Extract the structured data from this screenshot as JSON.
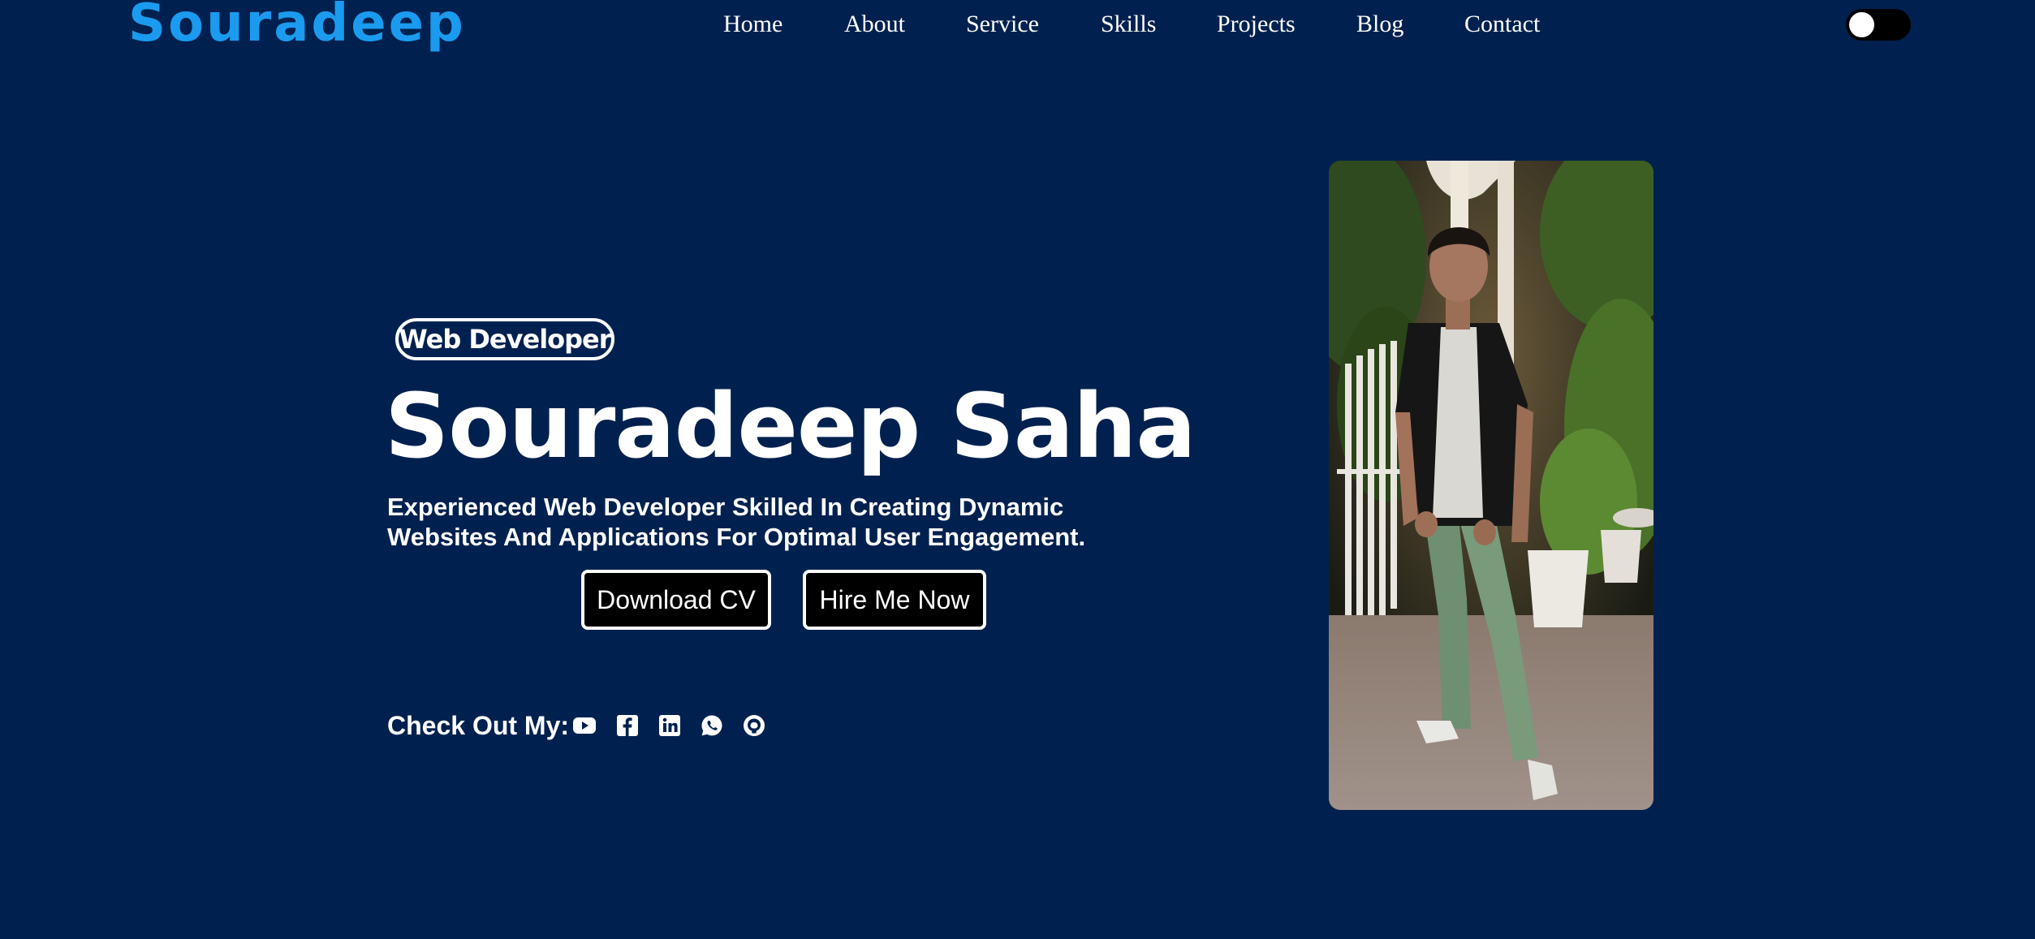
{
  "logo": "Souradeep",
  "nav": {
    "items": [
      "Home",
      "About",
      "Service",
      "Skills",
      "Projects",
      "Blog",
      "Contact"
    ]
  },
  "theme_toggle": {
    "state": "off"
  },
  "hero": {
    "badge": "Web Developer",
    "name": "Souradeep Saha",
    "description": "Experienced Web Developer Skilled In Creating Dynamic Websites And Applications For Optimal User Engagement.",
    "buttons": {
      "download_cv": "Download CV",
      "hire_me": "Hire Me Now"
    },
    "social": {
      "label": "Check Out My:",
      "icons": [
        "youtube-icon",
        "facebook-icon",
        "linkedin-icon",
        "whatsapp-icon",
        "github-icon"
      ]
    }
  },
  "colors": {
    "background": "#00214f",
    "logo": "#1a9bef",
    "button_bg": "#000000",
    "text": "#ffffff"
  }
}
